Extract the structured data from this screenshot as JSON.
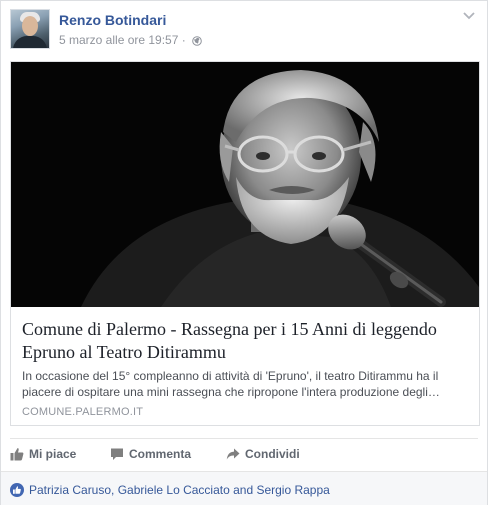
{
  "post": {
    "author": "Renzo Botindari",
    "timestamp": "5 marzo alle ore 19:57",
    "separator": "·",
    "privacy_icon": "globe-icon",
    "menu_icon": "chevron-down-icon"
  },
  "link": {
    "title": "Comune di Palermo - Rassegna per i 15 Anni di leggendo Epruno al Teatro Ditirammu",
    "description_line1": "In occasione del 15° compleanno di attività di 'Epruno', il teatro Ditirammu ha il",
    "description_line2": "piacere di ospitare una mini rassegna che ripropone l'intera produzione degli…",
    "domain": "COMUNE.PALERMO.IT"
  },
  "actions": {
    "like_label": "Mi piace",
    "comment_label": "Commenta",
    "share_label": "Condividi"
  },
  "likes": {
    "text": "Patrizia Caruso, Gabriele Lo Cacciato and Sergio Rappa"
  },
  "colors": {
    "link_blue": "#365899",
    "like_blue": "#4267b2",
    "meta_gray": "#90949c",
    "action_gray": "#616770"
  }
}
